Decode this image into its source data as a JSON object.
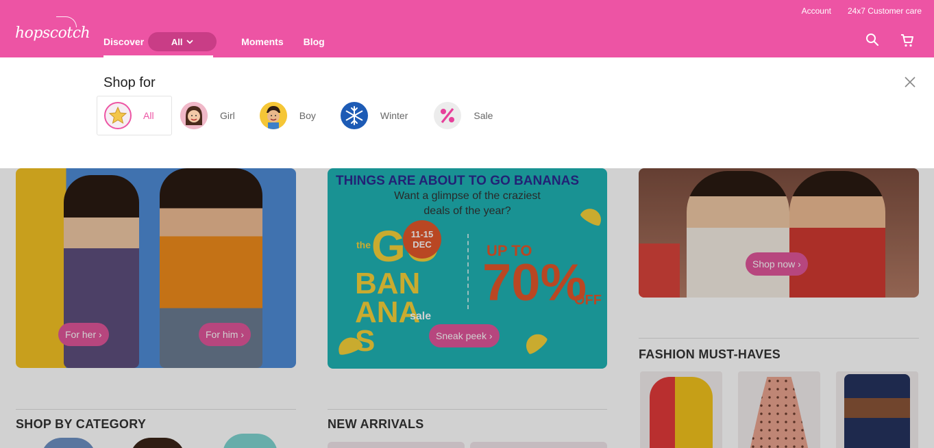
{
  "header": {
    "brand": "hopscotch",
    "util_links": [
      "Account",
      "24x7 Customer care"
    ],
    "nav": {
      "discover": "Discover",
      "all": "All",
      "moments": "Moments",
      "blog": "Blog"
    },
    "colors": {
      "brand_pink": "#ed54a4"
    }
  },
  "shop_panel": {
    "title": "Shop for",
    "options": [
      {
        "label": "All",
        "icon": "star-icon",
        "selected": true
      },
      {
        "label": "Girl",
        "icon": "girl-avatar",
        "selected": false
      },
      {
        "label": "Boy",
        "icon": "boy-avatar",
        "selected": false
      },
      {
        "label": "Winter",
        "icon": "snowflake-icon",
        "selected": false
      },
      {
        "label": "Sale",
        "icon": "percent-icon",
        "selected": false
      }
    ]
  },
  "banners": {
    "kids": {
      "left_button": "For her ›",
      "right_button": "For him ›"
    },
    "bananas": {
      "headline": "THINGS ARE ABOUT TO GO BANANAS",
      "subline": "Want a glimpse of the craziest deals of the year?",
      "the": "the",
      "go": "GO",
      "bananas": "BANANAS",
      "sale": "sale",
      "dates": "11-15",
      "month": "DEC",
      "upto": "UP TO",
      "percent": "70%",
      "off": "OFF",
      "button": "Sneak peek ›"
    },
    "holiday": {
      "button": "Shop now ›"
    }
  },
  "sections": {
    "category": "SHOP BY CATEGORY",
    "new_arrivals": "NEW ARRIVALS",
    "must_haves": "FASHION MUST-HAVES"
  }
}
